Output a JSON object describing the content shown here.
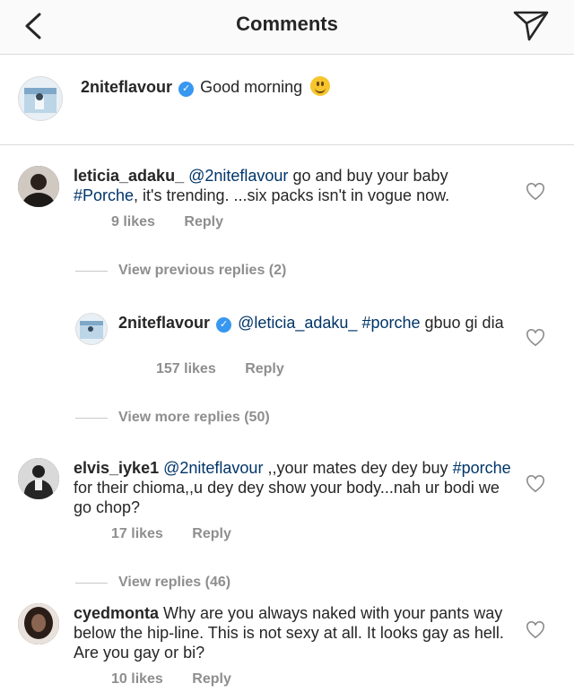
{
  "header": {
    "title": "Comments"
  },
  "caption": {
    "username": "2niteflavour",
    "text": "Good morning"
  },
  "comments": [
    {
      "username": "leticia_adaku_",
      "mention": "@2niteflavour",
      "text_a": " go and buy your  baby ",
      "hashtag": "#Porche",
      "text_b": ", it's trending. ...six packs isn't in vogue now.",
      "likes": "9 likes",
      "reply": "Reply"
    },
    {
      "username": "elvis_iyke1",
      "mention": "@2niteflavour",
      "text_a": " ,,your mates dey dey buy ",
      "hashtag": "#porche",
      "text_b": "  for their chioma,,u dey dey show your body...nah ur bodi we go chop?",
      "likes": "17 likes",
      "reply": "Reply"
    },
    {
      "username": "cyedmonta",
      "text": " Why are you always naked with your pants way below the hip-line. This is not sexy at all. It looks gay as hell. Are you gay or bi?",
      "likes": "10 likes",
      "reply": "Reply"
    }
  ],
  "reply_thread": {
    "view_previous": "View previous replies (2)",
    "view_more": "View more replies (50)",
    "reply": {
      "username": "2niteflavour",
      "mention": "@leticia_adaku_",
      "hashtag": "#porche",
      "text": " gbuo gi dia",
      "likes": "157 likes",
      "reply": "Reply"
    }
  },
  "view_replies_46": "View replies (46)",
  "icons": {
    "back": "chevron-left-icon",
    "send": "paper-plane-icon",
    "like": "heart-outline-icon",
    "verified": "verified-badge-icon",
    "emoji": "smiley-emoji-icon"
  },
  "colors": {
    "verified": "#3897f0",
    "link": "#003569",
    "muted": "#8e8e8e"
  }
}
